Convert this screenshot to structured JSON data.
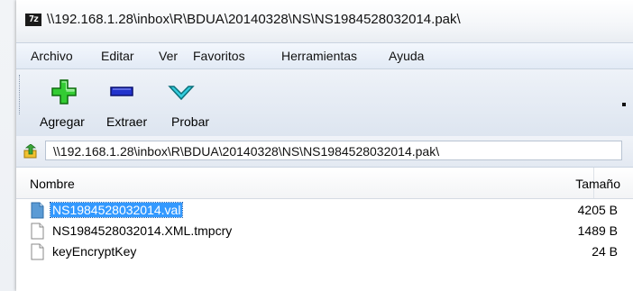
{
  "window": {
    "title": "\\\\192.168.1.28\\inbox\\R\\BDUA\\20140328\\NS\\NS1984528032014.pak\\",
    "app_icon_text": "7z"
  },
  "menu": {
    "items": [
      "Archivo",
      "Editar",
      "Ver",
      "Favoritos",
      "Herramientas",
      "Ayuda"
    ]
  },
  "toolbar": {
    "add_label": "Agregar",
    "add_icon": "plus-icon",
    "extract_label": "Extraer",
    "extract_icon": "minus-icon",
    "test_label": "Probar",
    "test_icon": "check-icon"
  },
  "address": {
    "path": "\\\\192.168.1.28\\inbox\\R\\BDUA\\20140328\\NS\\NS1984528032014.pak\\"
  },
  "columns": {
    "name": "Nombre",
    "size": "Tamaño"
  },
  "files": [
    {
      "name": "NS1984528032014.val",
      "size": "4205 B",
      "selected": true
    },
    {
      "name": "NS1984528032014.XML.tmpcry",
      "size": "1489 B",
      "selected": false
    },
    {
      "name": "keyEncryptKey",
      "size": "24 B",
      "selected": false
    }
  ],
  "colors": {
    "selection": "#3399ff",
    "add_green": "#33cc33",
    "extract_blue": "#2233cc",
    "test_cyan": "#33ccdd"
  }
}
